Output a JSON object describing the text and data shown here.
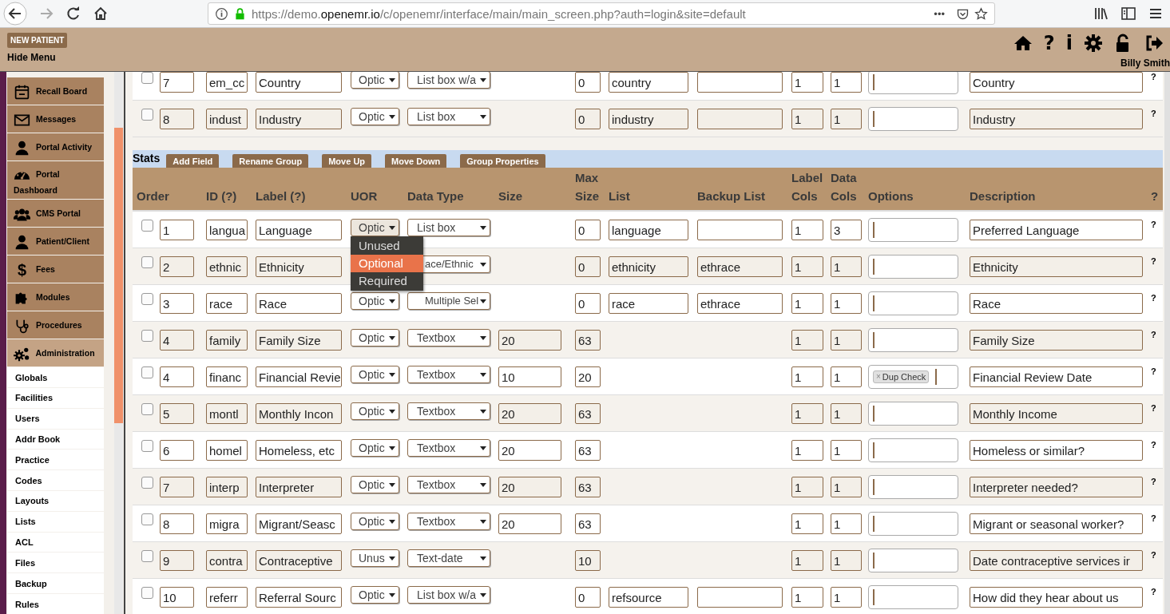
{
  "browser": {
    "url_prefix": "https://demo.",
    "url_host": "openemr.io",
    "url_path": "/c/openemr/interface/main/main_screen.php?auth=login&site=default",
    "more": "•••"
  },
  "header": {
    "new_patient": "NEW PATIENT",
    "hide_menu": "Hide Menu",
    "help": "?",
    "info": "i",
    "user": "Billy Smith"
  },
  "sidebar": {
    "items": [
      {
        "label": "Recall Board",
        "selected": false
      },
      {
        "label": "Messages",
        "selected": false
      },
      {
        "label": "Portal Activity",
        "selected": false
      },
      {
        "label": "Portal Dashboard",
        "selected": false
      },
      {
        "label": "CMS Portal",
        "selected": false
      },
      {
        "label": "Patient/Client",
        "selected": false
      },
      {
        "label": "Fees",
        "glyph": "$",
        "selected": false
      },
      {
        "label": "Modules",
        "selected": false
      },
      {
        "label": "Procedures",
        "selected": false
      },
      {
        "label": "Administration",
        "selected": true
      }
    ],
    "sub_items": [
      "Globals",
      "Facilities",
      "Users",
      "Addr Book",
      "Practice",
      "Codes",
      "Layouts",
      "Lists",
      "ACL",
      "Files",
      "Backup",
      "Rules"
    ]
  },
  "previous_group": {
    "rows": [
      {
        "checked": false,
        "kind": "list",
        "order": "7",
        "id": "em_cc",
        "label": "Country",
        "uor": "Optic",
        "data_type": "List box w/a",
        "max_size": "0",
        "list": "country",
        "label_cols": "1",
        "data_cols": "1",
        "description": "Country",
        "help": "?"
      },
      {
        "checked": false,
        "kind": "list",
        "order": "8",
        "id": "indust",
        "label": "Industry",
        "uor": "Optic",
        "data_type": "List box",
        "max_size": "0",
        "list": "industry",
        "label_cols": "1",
        "data_cols": "1",
        "description": "Industry",
        "help": "?"
      }
    ]
  },
  "group": {
    "name": "Stats",
    "buttons": [
      "Add Field",
      "Rename Group",
      "Move Up",
      "Move Down",
      "Group Properties"
    ],
    "columns": [
      "Order",
      "ID (?)",
      "Label (?)",
      "UOR",
      "Data Type",
      "Size",
      "Max Size",
      "List",
      "Backup List",
      "Label Cols",
      "Data Cols",
      "Options",
      "Description",
      "?"
    ],
    "rows": [
      {
        "checked": false,
        "kind": "list",
        "order": "1",
        "id": "langua",
        "label": "Language",
        "uor": "Optic",
        "data_type": "List box",
        "max_size": "0",
        "list": "language",
        "label_cols": "1",
        "data_cols": "3",
        "description": "Preferred Language",
        "help": "?"
      },
      {
        "checked": false,
        "kind": "list",
        "order": "2",
        "id": "ethnic",
        "label": "Ethnicity",
        "data_type": "ace/Ethnic",
        "max_size": "0",
        "list": "ethnicity",
        "backup_list": "ethrace",
        "label_cols": "1",
        "data_cols": "1",
        "description": "Ethnicity",
        "help": "?"
      },
      {
        "checked": false,
        "kind": "list",
        "order": "3",
        "id": "race",
        "label": "Race",
        "uor": "Optic",
        "data_type": "Multiple Sel",
        "max_size": "0",
        "list": "race",
        "backup_list": "ethrace",
        "label_cols": "1",
        "data_cols": "1",
        "description": "Race",
        "help": "?"
      },
      {
        "checked": false,
        "kind": "text",
        "order": "4",
        "id": "family",
        "label": "Family Size",
        "uor": "Optic",
        "data_type": "Textbox",
        "size": "20",
        "max_size": "63",
        "label_cols": "1",
        "data_cols": "1",
        "description": "Family Size",
        "help": "?"
      },
      {
        "checked": false,
        "kind": "text",
        "order": "4",
        "id": "financ",
        "label": "Financial Revie",
        "uor": "Optic",
        "data_type": "Textbox",
        "size": "10",
        "max_size": "20",
        "label_cols": "1",
        "data_cols": "1",
        "options": [
          {
            "remove": "×",
            "label": "Dup Check"
          }
        ],
        "description": "Financial Review Date",
        "help": "?"
      },
      {
        "checked": false,
        "kind": "text",
        "order": "5",
        "id": "montl",
        "label": "Monthly Incon",
        "uor": "Optic",
        "data_type": "Textbox",
        "size": "20",
        "max_size": "63",
        "label_cols": "1",
        "data_cols": "1",
        "description": "Monthly Income",
        "help": "?"
      },
      {
        "checked": false,
        "kind": "text",
        "order": "6",
        "id": "homel",
        "label": "Homeless, etc",
        "uor": "Optic",
        "data_type": "Textbox",
        "size": "20",
        "max_size": "63",
        "label_cols": "1",
        "data_cols": "1",
        "description": "Homeless or similar?",
        "help": "?"
      },
      {
        "checked": false,
        "kind": "text",
        "order": "7",
        "id": "interp",
        "label": "Interpreter",
        "uor": "Optic",
        "data_type": "Textbox",
        "size": "20",
        "max_size": "63",
        "label_cols": "1",
        "data_cols": "1",
        "description": "Interpreter needed?",
        "help": "?"
      },
      {
        "checked": false,
        "kind": "text",
        "order": "8",
        "id": "migra",
        "label": "Migrant/Seasc",
        "uor": "Optic",
        "data_type": "Textbox",
        "size": "20",
        "max_size": "63",
        "label_cols": "1",
        "data_cols": "1",
        "description": "Migrant or seasonal worker?",
        "help": "?"
      },
      {
        "checked": false,
        "kind": "date",
        "order": "9",
        "id": "contra",
        "label": "Contraceptive",
        "uor": "Unus",
        "data_type": "Text-date",
        "max_size": "10",
        "label_cols": "1",
        "data_cols": "1",
        "description": "Date contraceptive services ir",
        "help": "?"
      },
      {
        "checked": false,
        "kind": "list",
        "order": "10",
        "id": "referr",
        "label": "Referral Sourc",
        "uor": "Optic",
        "data_type": "List box w/a",
        "max_size": "0",
        "list": "refsource",
        "label_cols": "1",
        "data_cols": "1",
        "description": "How did they hear about us",
        "help": "?"
      }
    ],
    "uor_menu": [
      {
        "label": "Unused",
        "selected": false
      },
      {
        "label": "Optional",
        "selected": true
      },
      {
        "label": "Required",
        "selected": false
      }
    ]
  }
}
